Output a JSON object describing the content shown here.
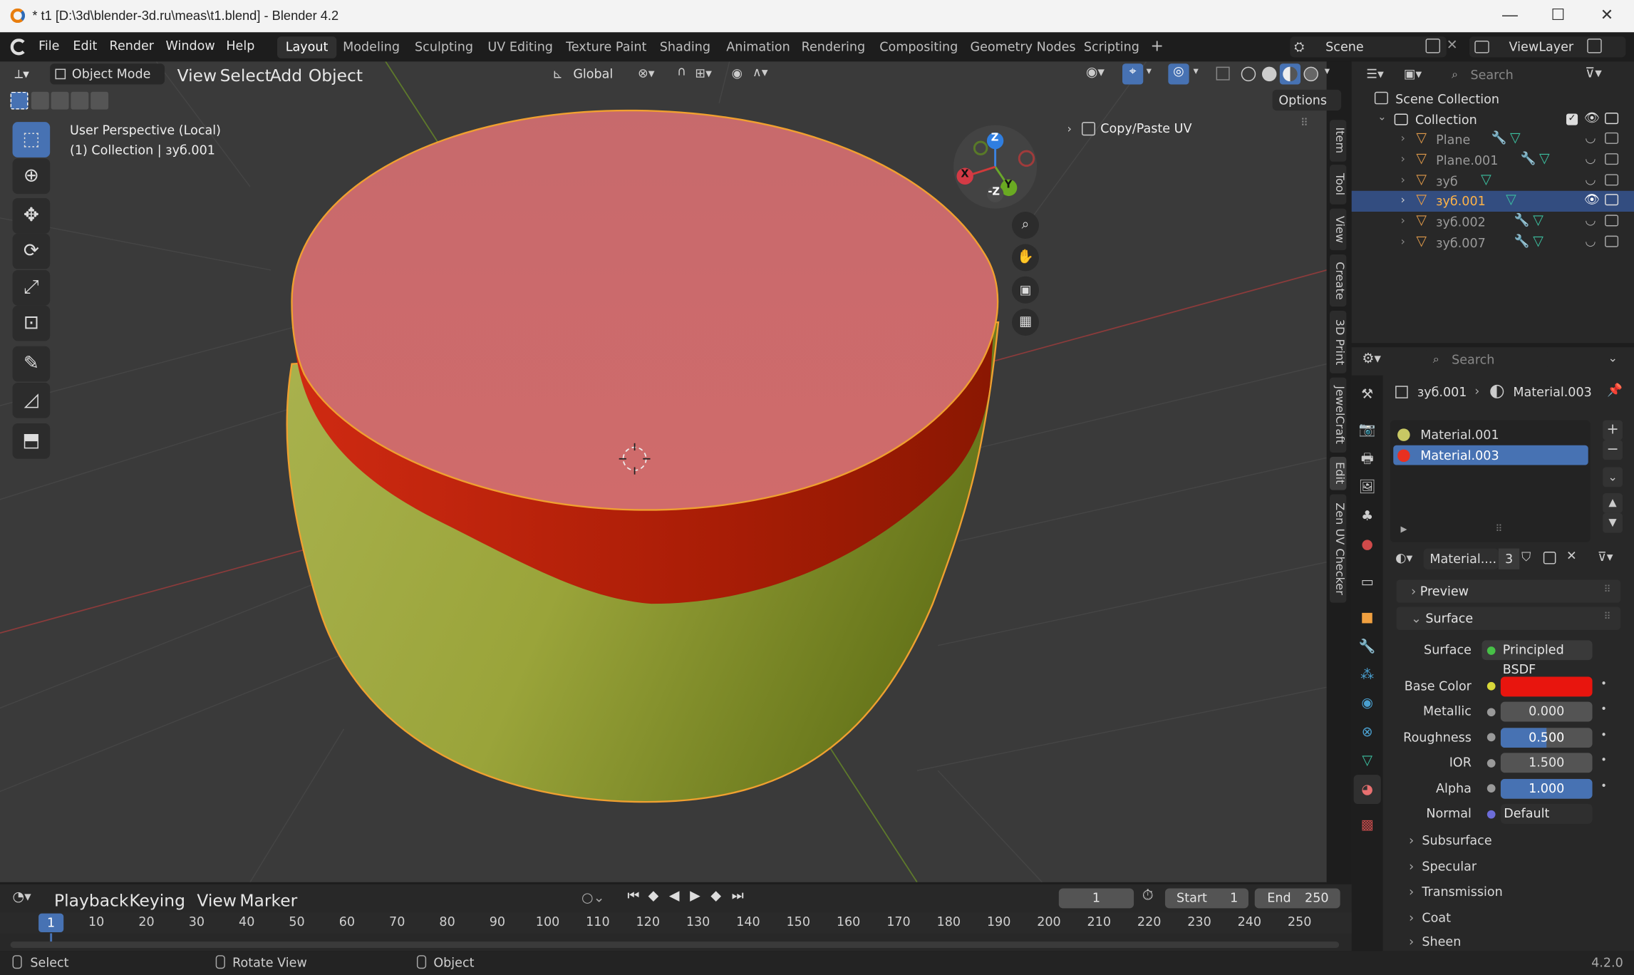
{
  "window": {
    "title": "* t1 [D:\\3d\\blender-3d.ru\\meas\\t1.blend] - Blender 4.2",
    "min": "—",
    "max": "☐",
    "close": "✕"
  },
  "menus": [
    "File",
    "Edit",
    "Render",
    "Window",
    "Help"
  ],
  "workspaces": [
    "Layout",
    "Modeling",
    "Sculpting",
    "UV Editing",
    "Texture Paint",
    "Shading",
    "Animation",
    "Rendering",
    "Compositing",
    "Geometry Nodes",
    "Scripting"
  ],
  "add_workspace": "+",
  "scene": {
    "name": "Scene",
    "view_layer": "ViewLayer"
  },
  "viewport": {
    "mode": "Object Mode",
    "menus": [
      "View",
      "Select",
      "Add",
      "Object"
    ],
    "orientation": "Global",
    "options": "Options",
    "info_line1": "User Perspective (Local)",
    "info_line2": "(1) Collection | зуб.001",
    "panel_title": "Copy/Paste UV",
    "gizmo": {
      "z": "Z",
      "y": "Y",
      "x": "X",
      "neg_z": "-Z"
    }
  },
  "ntabs": [
    "Item",
    "Tool",
    "View",
    "Create",
    "3D Print",
    "JewelCraft",
    "Edit",
    "Zen UV Checker"
  ],
  "outliner": {
    "search_placeholder": "Search",
    "scene_collection": "Scene Collection",
    "collection": "Collection",
    "objects": [
      {
        "name": "Plane",
        "selected": false
      },
      {
        "name": "Plane.001",
        "selected": false
      },
      {
        "name": "зуб",
        "selected": false
      },
      {
        "name": "зуб.001",
        "selected": true
      },
      {
        "name": "зуб.002",
        "selected": false
      },
      {
        "name": "зуб.007",
        "selected": false
      }
    ]
  },
  "properties": {
    "search_placeholder": "Search",
    "breadcrumb_object": "зуб.001",
    "breadcrumb_material": "Material.003",
    "slots": [
      {
        "name": "Material.001",
        "color": "#c8c864",
        "selected": false
      },
      {
        "name": "Material.003",
        "color": "#e83020",
        "selected": true
      }
    ],
    "material_field": "Material....",
    "users": "3",
    "preview": "Preview",
    "surface_section": "Surface",
    "surface_label": "Surface",
    "surface_value": "Principled BSDF",
    "base_color_label": "Base Color",
    "base_color": "#e8150e",
    "metallic_label": "Metallic",
    "metallic": "0.000",
    "roughness_label": "Roughness",
    "roughness": "0.500",
    "roughness_fill": 0.5,
    "ior_label": "IOR",
    "ior": "1.500",
    "alpha_label": "Alpha",
    "alpha": "1.000",
    "alpha_fill": 1.0,
    "normal_label": "Normal",
    "normal": "Default",
    "subsections": [
      "Subsurface",
      "Specular",
      "Transmission",
      "Coat",
      "Sheen"
    ]
  },
  "timeline": {
    "menus": [
      "Playback",
      "Keying",
      "View",
      "Marker"
    ],
    "current_frame": "1",
    "start_label": "Start",
    "start": "1",
    "end_label": "End",
    "end": "250",
    "ticks": [
      "10",
      "20",
      "30",
      "40",
      "50",
      "60",
      "70",
      "80",
      "90",
      "100",
      "110",
      "120",
      "130",
      "140",
      "150",
      "160",
      "170",
      "180",
      "190",
      "200",
      "210",
      "220",
      "230",
      "240",
      "250"
    ],
    "playhead": "1"
  },
  "status": {
    "select": "Select",
    "rotate": "Rotate View",
    "object": "Object",
    "version": "4.2.0"
  }
}
